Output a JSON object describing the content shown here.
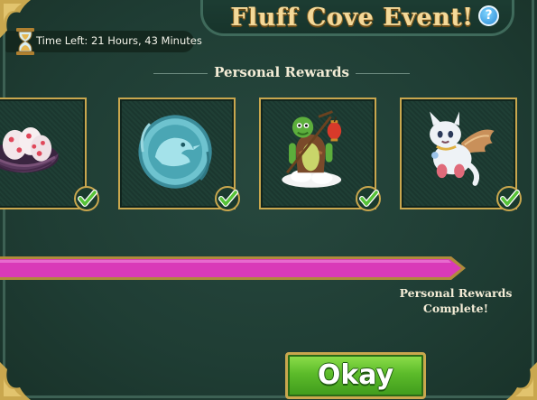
{
  "window": {
    "title": "Fluff Cove Event!",
    "help_icon": "question-mark-icon",
    "help_glyph": "?"
  },
  "timer": {
    "icon": "hourglass-icon",
    "text": "Time Left: 21 Hours, 43 Minutes"
  },
  "rewards": {
    "section_title": "Personal Rewards",
    "items": [
      {
        "name": "egg-nest",
        "claimed": true,
        "icon": "checkmark-icon"
      },
      {
        "name": "bird-coin",
        "claimed": true,
        "icon": "checkmark-icon"
      },
      {
        "name": "turtle-with-lantern",
        "claimed": true,
        "icon": "checkmark-icon"
      },
      {
        "name": "winged-fluff-creature",
        "claimed": true,
        "icon": "checkmark-icon"
      }
    ]
  },
  "progress": {
    "fraction": 1.0,
    "label_line1": "Personal Rewards",
    "label_line2": "Complete!"
  },
  "actions": {
    "okay_label": "Okay"
  },
  "colors": {
    "background": "#1f3d34",
    "title_gold": "#f4d999",
    "frame_gold": "#c9a74e",
    "progress_fill": "#d93ab8",
    "check_green": "#56c238",
    "button_green": "#5cbb2a"
  }
}
